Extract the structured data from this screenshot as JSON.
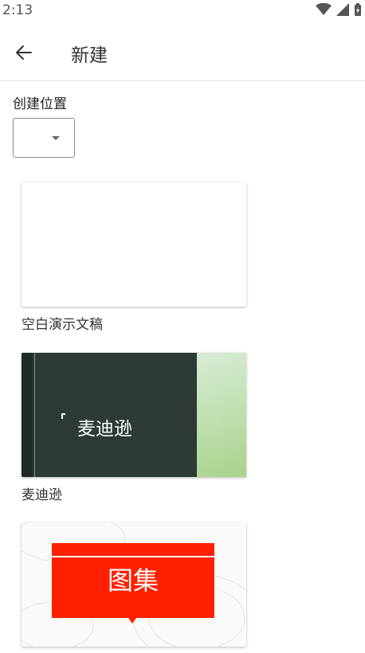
{
  "status_bar": {
    "time": "2:13"
  },
  "app_bar": {
    "title": "新建"
  },
  "location": {
    "label": "创建位置",
    "selected_value": ""
  },
  "templates": [
    {
      "label": "空白演示文稿",
      "thumbnail_text": ""
    },
    {
      "label": "麦迪逊",
      "thumbnail_text": "麦迪逊"
    },
    {
      "label": "",
      "thumbnail_text": "图集"
    }
  ],
  "colors": {
    "accent_red": "#ff2000",
    "madison_dark": "#2d3a36"
  }
}
